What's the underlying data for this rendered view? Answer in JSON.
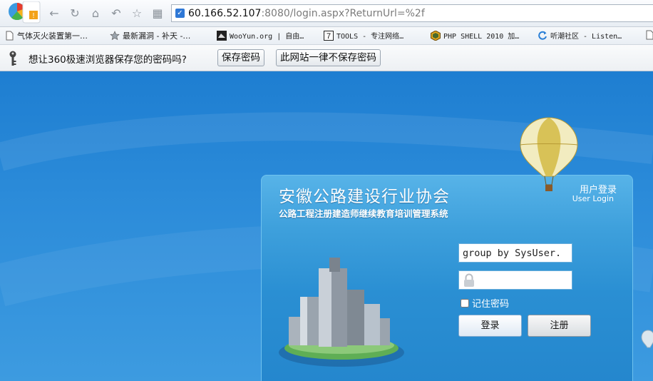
{
  "browser": {
    "address": {
      "host": "60.166.52.107",
      "rest": ":8080/login.aspx?ReturnUrl=%2f"
    },
    "bookmarks": [
      {
        "label": "气体灭火装置第一…",
        "icon": "page-icon"
      },
      {
        "label": "最新漏洞 - 补天 -…",
        "icon": "star-icon"
      },
      {
        "label": "WooYun.org | 自由…",
        "icon": "wooyun-icon"
      },
      {
        "label": "TOOLS - 专注网络…",
        "icon": "tools-icon"
      },
      {
        "label": "PHP SHELL 2010 加…",
        "icon": "php-icon"
      },
      {
        "label": "听潮社区 - Listen…",
        "icon": "refresh-icon"
      }
    ]
  },
  "password_bar": {
    "message": "想让360极速浏览器保存您的密码吗?",
    "save_label": "保存密码",
    "never_label": "此网站一律不保存密码"
  },
  "login": {
    "title": "安徽公路建设行业协会",
    "subtitle": "公路工程注册建造师继续教育培训管理系统",
    "heading_cn": "用户登录",
    "heading_en": "User Login",
    "username_value": "group by SysUser.",
    "remember_label": "记住密码",
    "login_label": "登录",
    "register_label": "注册"
  },
  "colors": {
    "background": "#1f7fd0",
    "panel": "#3ea0dc",
    "accent": "#2f78d6"
  }
}
